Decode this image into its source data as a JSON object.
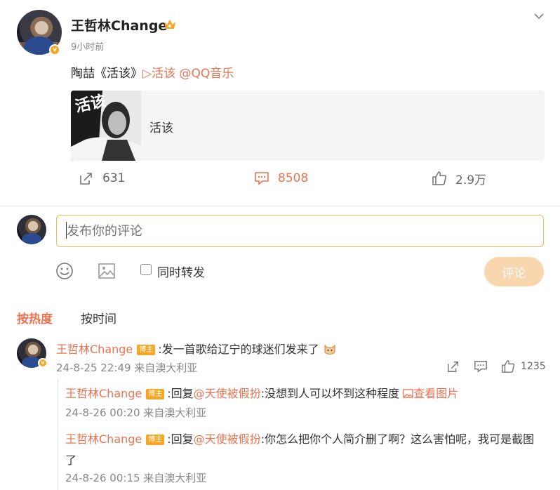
{
  "post": {
    "author": "王哲林Change",
    "time": "9小时前",
    "text_prefix": "陶喆《活该》",
    "music_link": "▷活该",
    "mention": "@QQ音乐",
    "card_title": "活该",
    "cover_text": "活该"
  },
  "actions": {
    "repost_count": "631",
    "comment_count": "8508",
    "like_count": "2.9万"
  },
  "composer": {
    "placeholder": "发布你的评论",
    "repost_label": "同时转发",
    "submit_label": "评论"
  },
  "sort": {
    "hot": "按热度",
    "time": "按时间"
  },
  "comments": [
    {
      "author": "王哲林Change",
      "badge": "博主",
      "text": ":发一首歌给辽宁的球迷们发来了",
      "meta": "24-8-25 22:49 来自澳大利亚",
      "like_count": "1235"
    }
  ],
  "replies": [
    {
      "author": "王哲林Change",
      "badge": "博主",
      "reply_word": ":回复",
      "mention": "@天使被假扮",
      "text": ":没想到人可以坏到这种程度",
      "view_image": "查看图片",
      "meta": "24-8-26 00:20 来自澳大利亚"
    },
    {
      "author": "王哲林Change",
      "badge": "博主",
      "reply_word": ":回复",
      "mention": "@天使被假扮",
      "text_line1": ":你怎么把你个人简介删了啊？这么害怕呢，我可是截图",
      "text_line2": "了",
      "meta": "24-8-26 00:15 来自澳大利亚"
    }
  ],
  "colors": {
    "accent": "#eb7350",
    "badge": "#f5a623",
    "submit_bg": "#fad6ae",
    "input_border": "#f0b95b"
  },
  "icons": [
    "chevron-down-icon",
    "crown-icon",
    "verified-icon",
    "repost-icon",
    "comment-icon",
    "like-icon",
    "emoji-icon",
    "image-icon",
    "cat-emoji-icon"
  ]
}
